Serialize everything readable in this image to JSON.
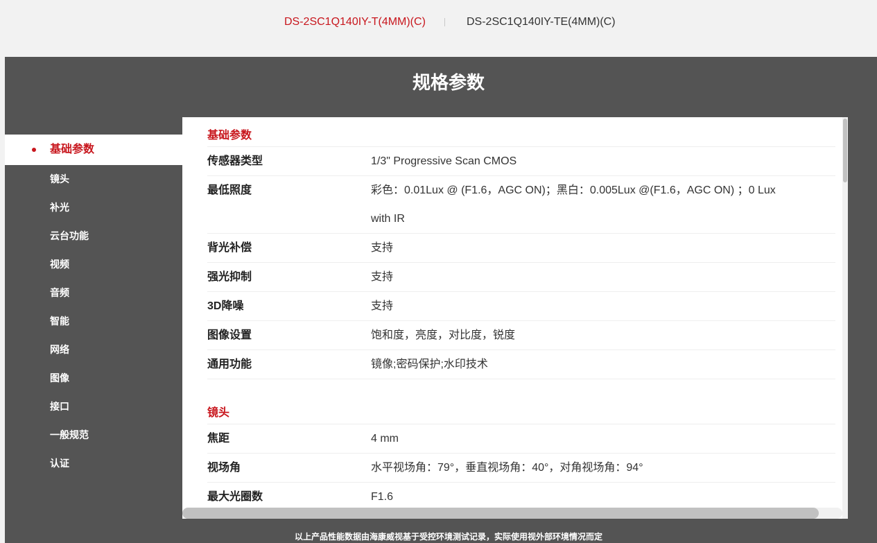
{
  "model_tabs": [
    {
      "label": "DS-2SC1Q140IY-T(4MM)(C)",
      "active": true
    },
    {
      "label": "DS-2SC1Q140IY-TE(4MM)(C)",
      "active": false
    }
  ],
  "panel_title": "规格参数",
  "nav": [
    {
      "label": "基础参数",
      "active": true
    },
    {
      "label": "镜头"
    },
    {
      "label": "补光"
    },
    {
      "label": "云台功能"
    },
    {
      "label": "视频"
    },
    {
      "label": "音频"
    },
    {
      "label": "智能"
    },
    {
      "label": "网络"
    },
    {
      "label": "图像"
    },
    {
      "label": "接口"
    },
    {
      "label": "一般规范"
    },
    {
      "label": "认证"
    }
  ],
  "sections": [
    {
      "title": "基础参数",
      "rows": [
        {
          "label": "传感器类型",
          "value": "1/3\" Progressive Scan CMOS"
        },
        {
          "label": "最低照度",
          "value": "彩色：0.01Lux @ (F1.6，AGC ON)；黑白：0.005Lux @(F1.6，AGC ON) ；0 Lux with IR"
        },
        {
          "label": "背光补偿",
          "value": "支持"
        },
        {
          "label": "强光抑制",
          "value": "支持"
        },
        {
          "label": "3D降噪",
          "value": "支持"
        },
        {
          "label": "图像设置",
          "value": "饱和度，亮度，对比度，锐度"
        },
        {
          "label": "通用功能",
          "value": "镜像;密码保护;水印技术"
        }
      ]
    },
    {
      "title": "镜头",
      "rows": [
        {
          "label": "焦距",
          "value": "4 mm"
        },
        {
          "label": "视场角",
          "value": "水平视场角：79°，垂直视场角：40°，对角视场角：94°"
        },
        {
          "label": "最大光圈数",
          "value": "F1.6"
        }
      ]
    }
  ],
  "footnote": "以上产品性能数据由海康威视基于受控环境测试记录，实际使用视外部环境情况而定"
}
